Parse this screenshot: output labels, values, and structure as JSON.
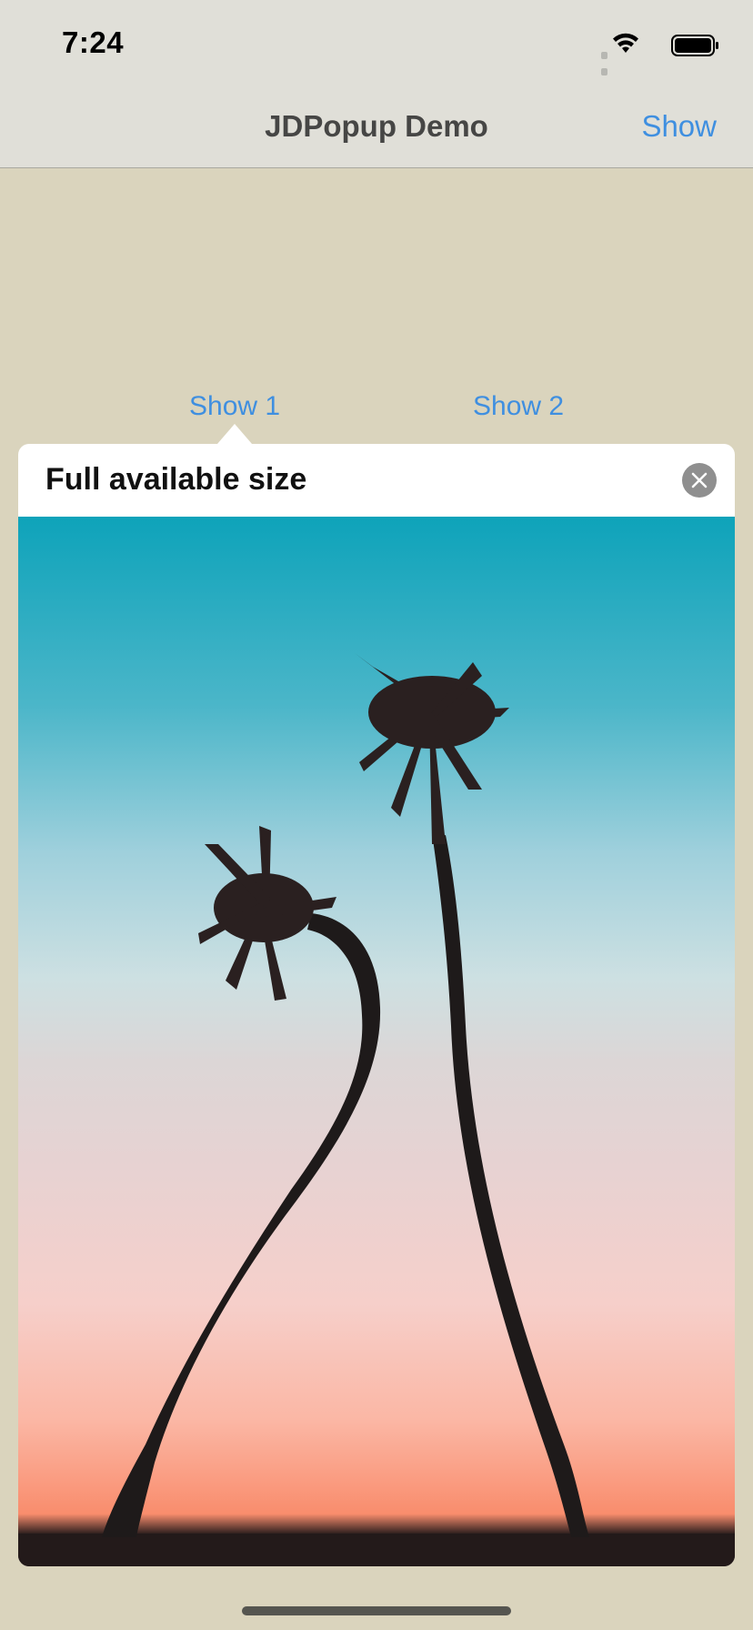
{
  "status_bar": {
    "time": "7:24",
    "icons": [
      "cellular-signal-icon",
      "wifi-icon",
      "battery-icon"
    ]
  },
  "nav_bar": {
    "title": "JDPopup Demo",
    "show_label": "Show"
  },
  "content": {
    "show1_label": "Show 1",
    "show2_label": "Show 2"
  },
  "popup": {
    "title": "Full available size",
    "close_icon": "close-icon",
    "image": "palm-trees-sunset-photo"
  },
  "colors": {
    "accent": "#3f8fe0",
    "background": "#dad4bd",
    "bar": "#e0dfd8"
  }
}
